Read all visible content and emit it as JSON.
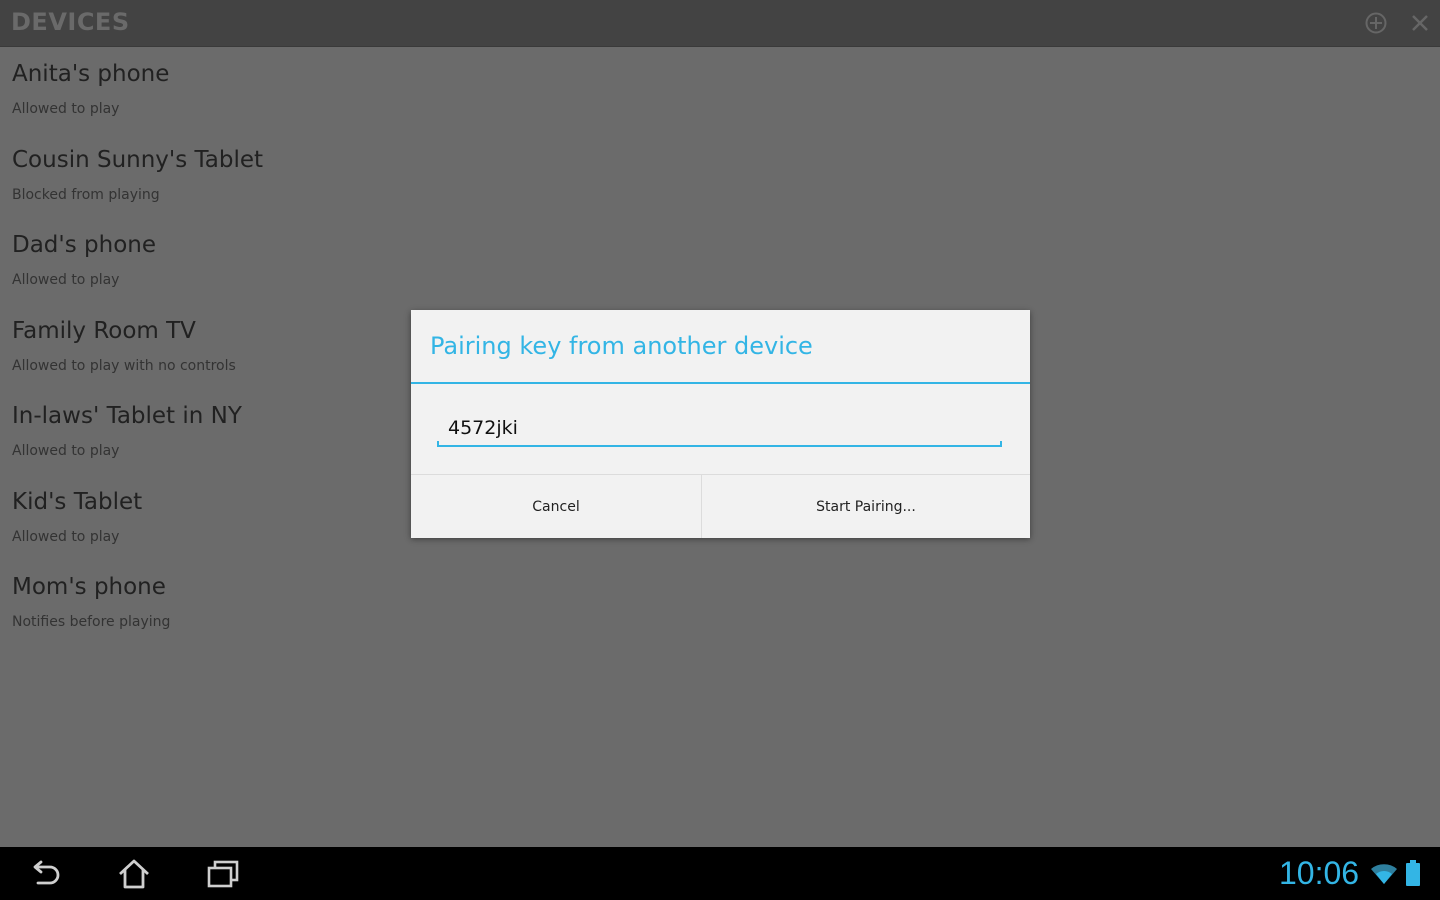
{
  "action_bar": {
    "title": "DEVICES",
    "icons": [
      "add-icon",
      "close-icon"
    ]
  },
  "devices": [
    {
      "name": "Anita's phone",
      "status": "Allowed to play"
    },
    {
      "name": "Cousin Sunny's Tablet",
      "status": "Blocked from playing"
    },
    {
      "name": "Dad's phone",
      "status": "Allowed to play"
    },
    {
      "name": "Family Room TV",
      "status": "Allowed to play with no controls"
    },
    {
      "name": "In-laws' Tablet in NY",
      "status": "Allowed to play"
    },
    {
      "name": "Kid's Tablet",
      "status": "Allowed to play"
    },
    {
      "name": "Mom's phone",
      "status": "Notifies before playing"
    }
  ],
  "dialog": {
    "title": "Pairing key from another device",
    "input_value": "4572jki",
    "cancel_label": "Cancel",
    "confirm_label": "Start Pairing..."
  },
  "nav_bar": {
    "icons": [
      "back-icon",
      "home-icon",
      "recents-icon",
      "wifi-icon",
      "battery-icon"
    ],
    "clock": "10:06"
  },
  "colors": {
    "accent": "#33b5e5",
    "dim_overlay_background": "#6b6b6b",
    "action_bar": "#434343",
    "nav_bar": "#000000",
    "dialog_background": "#f2f2f2"
  }
}
